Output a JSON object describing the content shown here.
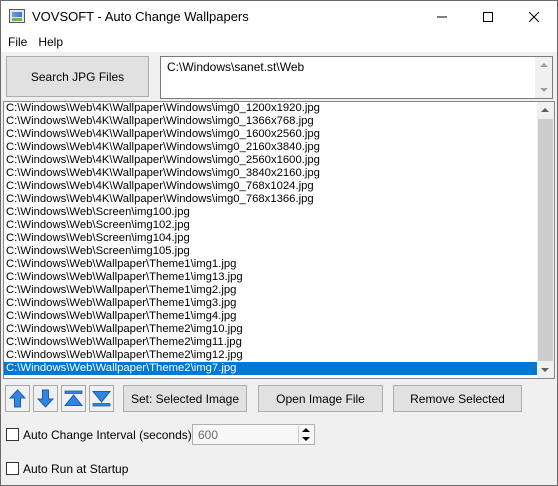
{
  "window": {
    "title": "VOVSOFT - Auto Change Wallpapers"
  },
  "menu": {
    "items": [
      {
        "label": "File"
      },
      {
        "label": "Help"
      }
    ]
  },
  "search": {
    "button_label": "Search JPG Files",
    "path": "C:\\Windows\\sanet.st\\Web"
  },
  "file_list": {
    "items": [
      "C:\\Windows\\Web\\4K\\Wallpaper\\Windows\\img0_1200x1920.jpg",
      "C:\\Windows\\Web\\4K\\Wallpaper\\Windows\\img0_1366x768.jpg",
      "C:\\Windows\\Web\\4K\\Wallpaper\\Windows\\img0_1600x2560.jpg",
      "C:\\Windows\\Web\\4K\\Wallpaper\\Windows\\img0_2160x3840.jpg",
      "C:\\Windows\\Web\\4K\\Wallpaper\\Windows\\img0_2560x1600.jpg",
      "C:\\Windows\\Web\\4K\\Wallpaper\\Windows\\img0_3840x2160.jpg",
      "C:\\Windows\\Web\\4K\\Wallpaper\\Windows\\img0_768x1024.jpg",
      "C:\\Windows\\Web\\4K\\Wallpaper\\Windows\\img0_768x1366.jpg",
      "C:\\Windows\\Web\\Screen\\img100.jpg",
      "C:\\Windows\\Web\\Screen\\img102.jpg",
      "C:\\Windows\\Web\\Screen\\img104.jpg",
      "C:\\Windows\\Web\\Screen\\img105.jpg",
      "C:\\Windows\\Web\\Wallpaper\\Theme1\\img1.jpg",
      "C:\\Windows\\Web\\Wallpaper\\Theme1\\img13.jpg",
      "C:\\Windows\\Web\\Wallpaper\\Theme1\\img2.jpg",
      "C:\\Windows\\Web\\Wallpaper\\Theme1\\img3.jpg",
      "C:\\Windows\\Web\\Wallpaper\\Theme1\\img4.jpg",
      "C:\\Windows\\Web\\Wallpaper\\Theme2\\img10.jpg",
      "C:\\Windows\\Web\\Wallpaper\\Theme2\\img11.jpg",
      "C:\\Windows\\Web\\Wallpaper\\Theme2\\img12.jpg",
      "C:\\Windows\\Web\\Wallpaper\\Theme2\\img7.jpg"
    ],
    "selected_index": 20,
    "selection_color": "#0078d7"
  },
  "toolbar": {
    "move_up_icon": "arrow-up-icon",
    "move_down_icon": "arrow-down-icon",
    "move_top_icon": "arrow-top-icon",
    "move_bottom_icon": "arrow-bottom-icon",
    "icon_color": "#2f86e0",
    "set_label": "Set: Selected Image",
    "open_label": "Open Image File",
    "remove_label": "Remove Selected"
  },
  "options": {
    "interval_label": "Auto Change Interval (seconds):",
    "interval_checked": false,
    "interval_value": "600",
    "startup_label": "Auto Run at Startup",
    "startup_checked": false
  }
}
